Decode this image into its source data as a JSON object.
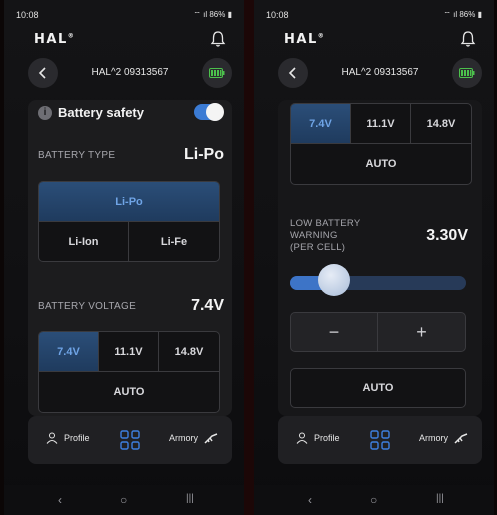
{
  "status": {
    "time": "10:08",
    "battery": "86%"
  },
  "app": {
    "logo": "HAL",
    "logo_sup": "®"
  },
  "device": {
    "name": "HAL^2 09313567"
  },
  "safety": {
    "title": "Battery safety",
    "enabled": true
  },
  "battery_type": {
    "label": "BATTERY TYPE",
    "value": "Li-Po",
    "options": [
      "Li-Po",
      "Li-Ion",
      "Li-Fe"
    ],
    "selected": "Li-Po"
  },
  "battery_voltage": {
    "label": "BATTERY VOLTAGE",
    "value": "7.4V",
    "options": [
      "7.4V",
      "11.1V",
      "14.8V"
    ],
    "auto_label": "AUTO",
    "selected": "7.4V"
  },
  "low_warning": {
    "label_line1": "LOW BATTERY",
    "label_line2": "WARNING",
    "label_line3": "(PER CELL)",
    "value": "3.30V",
    "slider_fraction": 0.25,
    "minus": "−",
    "plus": "+",
    "auto_label": "AUTO"
  },
  "bottom_nav": {
    "profile": "Profile",
    "armory": "Armory"
  },
  "system_nav": {
    "back": "‹",
    "home": "○",
    "recents": "|||"
  },
  "colors": {
    "accent": "#3b7bd4",
    "active_segment_text": "#6fa4e6",
    "battery_icon": "#4cc04c"
  }
}
